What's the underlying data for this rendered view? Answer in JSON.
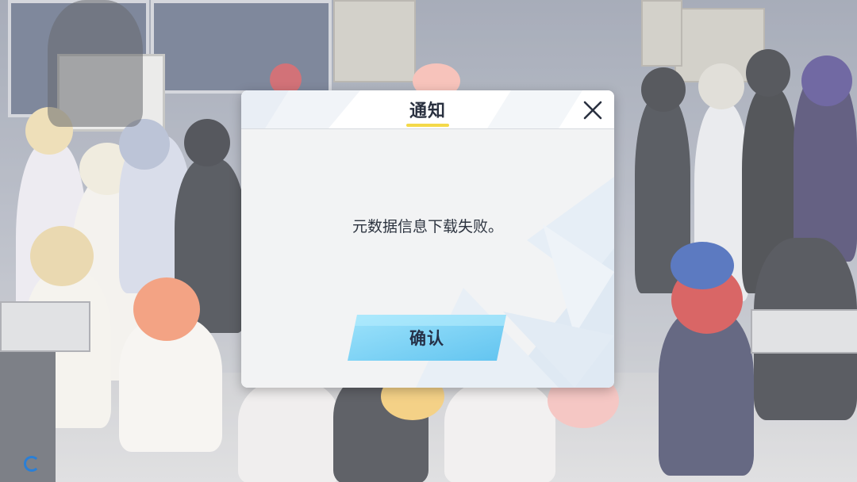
{
  "dialog": {
    "title": "通知",
    "message": "元数据信息下载失败。",
    "confirm_label": "确认",
    "close_icon": "close-icon"
  },
  "colors": {
    "title_underline": "#f4d94a",
    "confirm_button": "#7fd2f5",
    "dialog_bg": "#f4f5f6",
    "text": "#2d3440"
  },
  "background": {
    "description_icon": "loading-spinner-icon"
  }
}
